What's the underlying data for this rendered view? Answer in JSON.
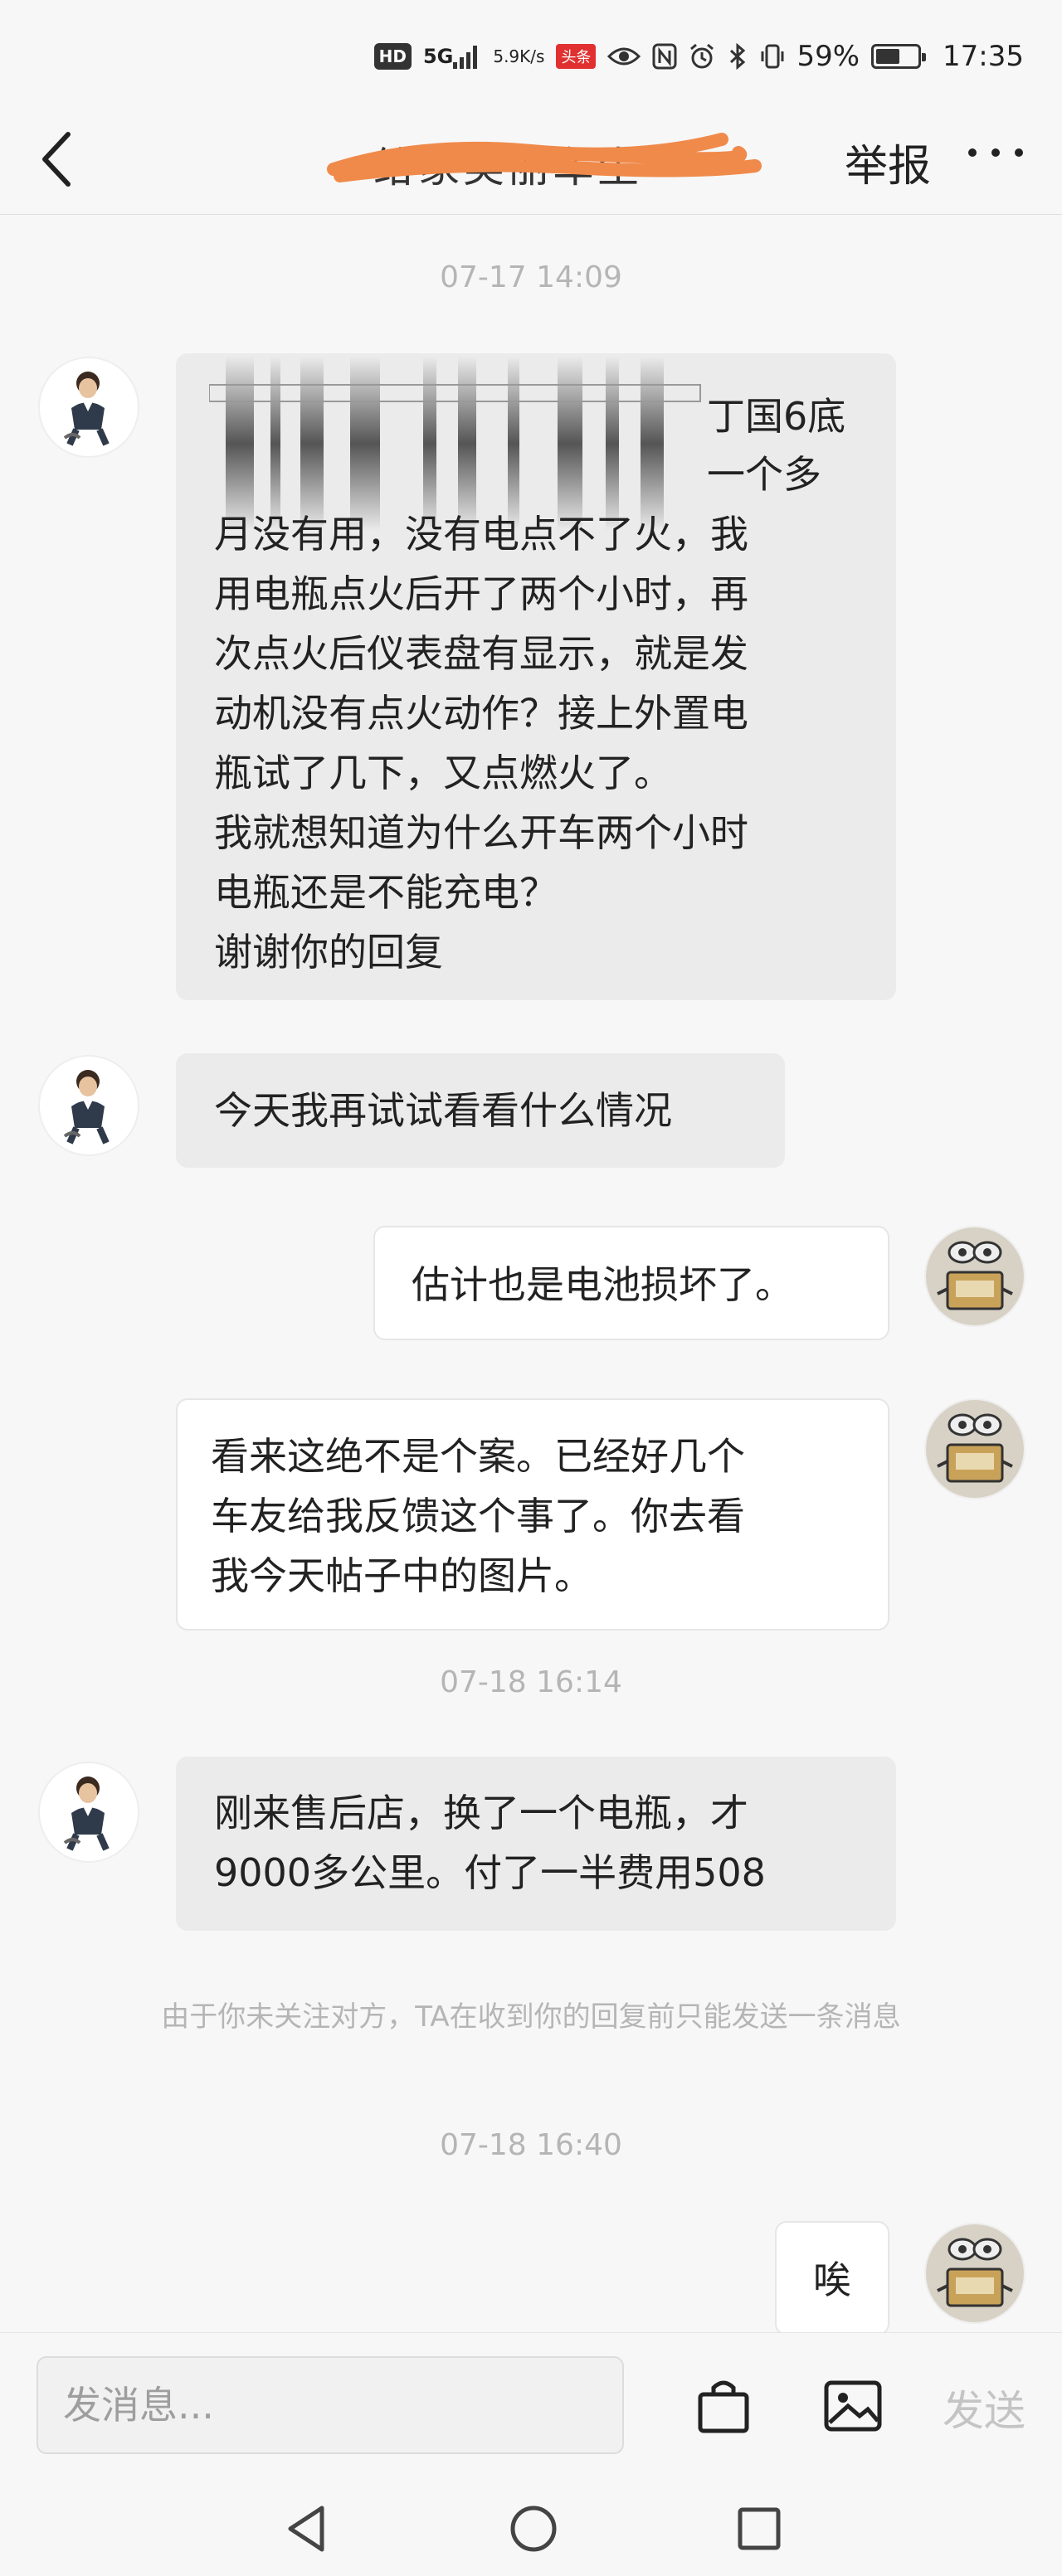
{
  "status_bar": {
    "hd": "HD",
    "network": "5G",
    "speed_value": "5.9",
    "speed_unit": "K/s",
    "app_badge": "头条",
    "battery_text": "59%",
    "battery_level": 0.59,
    "time": "17:35"
  },
  "header": {
    "title": "给家美丽车生",
    "report_label": "举报"
  },
  "messages": {
    "ts1": "07-17 14:09",
    "m1_lines": [
      "丁国6底",
      "一个多",
      "月没有用，没有电点不了火，我",
      "用电瓶点火后开了两个小时，再",
      "次点火后仪表盘有显示，就是发",
      "动机没有点火动作？接上外置电",
      "瓶试了几下，又点燃火了。",
      "我就想知道为什么开车两个小时",
      "电瓶还是不能充电？",
      "谢谢你的回复"
    ],
    "m2": "今天我再试试看看什么情况",
    "m3": "估计也是电池损坏了。",
    "m4_lines": [
      "看来这绝不是个案。已经好几个",
      "车友给我反馈这个事了。你去看",
      "我今天帖子中的图片。"
    ],
    "ts2": "07-18 16:14",
    "m5_lines": [
      "刚来售后店，换了一个电瓶，才",
      "9000多公里。付了一半费用508"
    ],
    "notice": "由于你未关注对方，TA在收到你的回复前只能发送一条消息",
    "ts3": "07-18 16:40",
    "m6": "唉"
  },
  "composer": {
    "placeholder": "发消息...",
    "send_label": "发送"
  },
  "icons": {
    "back": "back-arrow-icon",
    "more": "more-dots-icon",
    "bag": "shopping-bag-icon",
    "image": "image-icon",
    "nav_back": "nav-back-triangle-icon",
    "nav_home": "nav-home-circle-icon",
    "nav_recent": "nav-recent-square-icon"
  },
  "colors": {
    "background": "#f7f7f7",
    "incoming_bubble": "#ebebeb",
    "outgoing_bubble": "#ffffff",
    "timestamp": "#b5b5b5",
    "scribble": "#f08a4b",
    "send_disabled": "#c4c4c4"
  }
}
